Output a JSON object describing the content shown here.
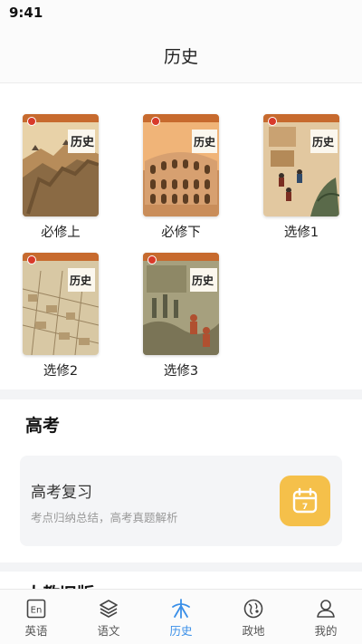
{
  "status_bar": {
    "time": "9:41"
  },
  "nav": {
    "title": "历史"
  },
  "books": [
    {
      "label": "必修上",
      "cover_title": "历史"
    },
    {
      "label": "必修下",
      "cover_title": "历史"
    },
    {
      "label": "选修1",
      "cover_title": "历史"
    },
    {
      "label": "选修2",
      "cover_title": "历史"
    },
    {
      "label": "选修3",
      "cover_title": "历史"
    }
  ],
  "gaokao": {
    "section_title": "高考",
    "card_title": "高考复习",
    "card_subtitle": "考点归纳总结，高考真题解析",
    "card_icon_number": "7"
  },
  "next_section": {
    "title": "人教旧版"
  },
  "tabs": [
    {
      "label": "英语",
      "icon": "en-icon"
    },
    {
      "label": "语文",
      "icon": "layers-icon"
    },
    {
      "label": "历史",
      "icon": "history-icon",
      "active": true
    },
    {
      "label": "政地",
      "icon": "globe-pin-icon"
    },
    {
      "label": "我的",
      "icon": "user-icon"
    }
  ],
  "colors": {
    "accent": "#3a8fe8",
    "calendar_icon_bg": "#f5c04a",
    "card_bg": "#f4f5f7"
  }
}
